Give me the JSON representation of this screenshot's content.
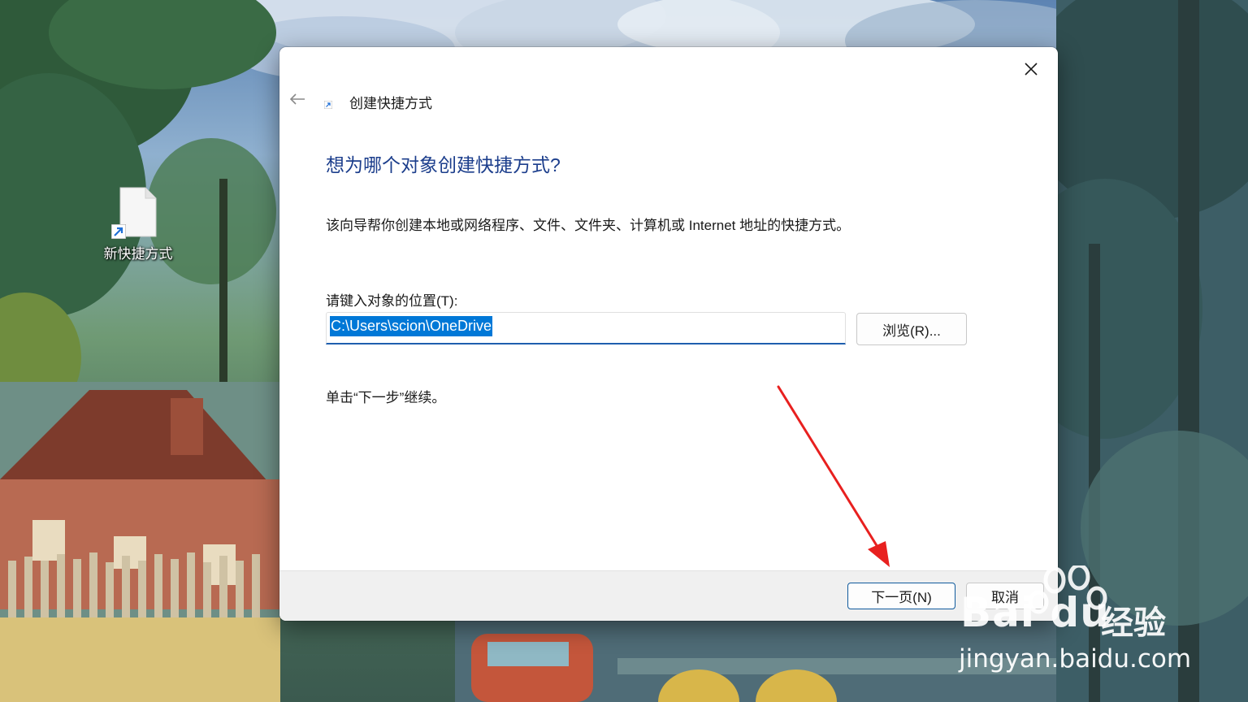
{
  "desktop": {
    "icon_label": "新快捷方式"
  },
  "dialog": {
    "title": "创建快捷方式",
    "heading": "想为哪个对象创建快捷方式?",
    "description": "该向导帮你创建本地或网络程序、文件、文件夹、计算机或 Internet 地址的快捷方式。",
    "location_label": "请键入对象的位置(T):",
    "location_value": "C:\\Users\\scion\\OneDrive",
    "browse_label": "浏览(R)...",
    "hint": "单击“下一步”继续。",
    "next_label": "下一页(N)",
    "cancel_label": "取消"
  },
  "watermark": {
    "brand": "Bai  du",
    "brand_cn": "经验",
    "url": "jingyan.baidu.com"
  },
  "colors": {
    "accent": "#0078d7",
    "heading": "#1c3e8c",
    "annotation_arrow": "#e8201f"
  },
  "icons": [
    "close-icon",
    "back-arrow-icon",
    "shortcut-arrow-icon",
    "file-icon"
  ]
}
